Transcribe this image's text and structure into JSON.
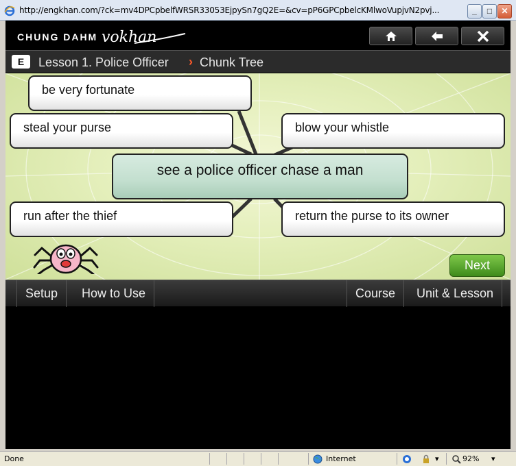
{
  "window": {
    "title": "http://engkhan.com/?ck=mv4DPCpbelfWRSR33053EjpySn7gQ2E=&cv=pP6GPCpbelcKMlwoVupjvN2pvj...",
    "min_glyph": "_",
    "max_glyph": "□",
    "close_glyph": "✕"
  },
  "header": {
    "brand": "CHUNG DAHM",
    "logo_text": "vokhan"
  },
  "breadcrumb": {
    "badge": "E",
    "lesson": "Lesson 1. Police Officer",
    "separator": "›",
    "page": "Chunk Tree"
  },
  "chunks": {
    "center": "see a police officer chase a man",
    "top": "be very fortunate",
    "left_upper": "steal your purse",
    "right_upper": "blow your whistle",
    "left_lower": "run after the thief",
    "right_lower": "return the purse to its owner"
  },
  "next_label": "Next",
  "menu": {
    "setup": "Setup",
    "how_to_use": "How to Use",
    "course": "Course",
    "unit_lesson": "Unit & Lesson"
  },
  "status": {
    "left": "Done",
    "zone": "Internet",
    "zoom": "92%"
  },
  "colors": {
    "accent_next": "#4f9e26",
    "breadcrumb_separator": "#ff5a2a",
    "center_chunk": "#c3dfcf"
  }
}
